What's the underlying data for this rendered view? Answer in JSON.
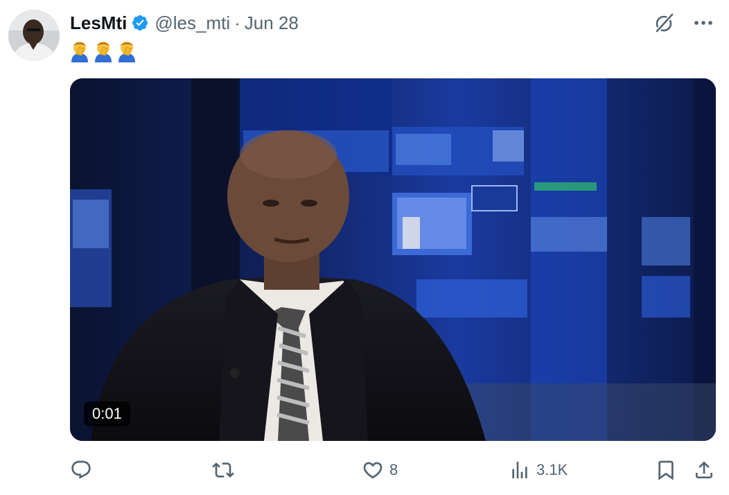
{
  "author": {
    "name": "LesMti",
    "handle": "@les_mti",
    "separator": "·",
    "date": "Jun 28",
    "verified": true,
    "verified_color": "#1d9bf0"
  },
  "tweet": {
    "text": "🤦‍♂️🤦‍♂️🤦‍♂️",
    "emoji_icons": [
      "man-facepalming-icon",
      "man-facepalming-icon",
      "man-facepalming-icon"
    ]
  },
  "media": {
    "type": "video",
    "duration": "0:01"
  },
  "actions": {
    "reply_count": "",
    "retweet_count": "",
    "like_count": "8",
    "views_count": "3.1K"
  },
  "colors": {
    "text_primary": "#0f1419",
    "text_secondary": "#536471",
    "accent": "#1d9bf0"
  }
}
